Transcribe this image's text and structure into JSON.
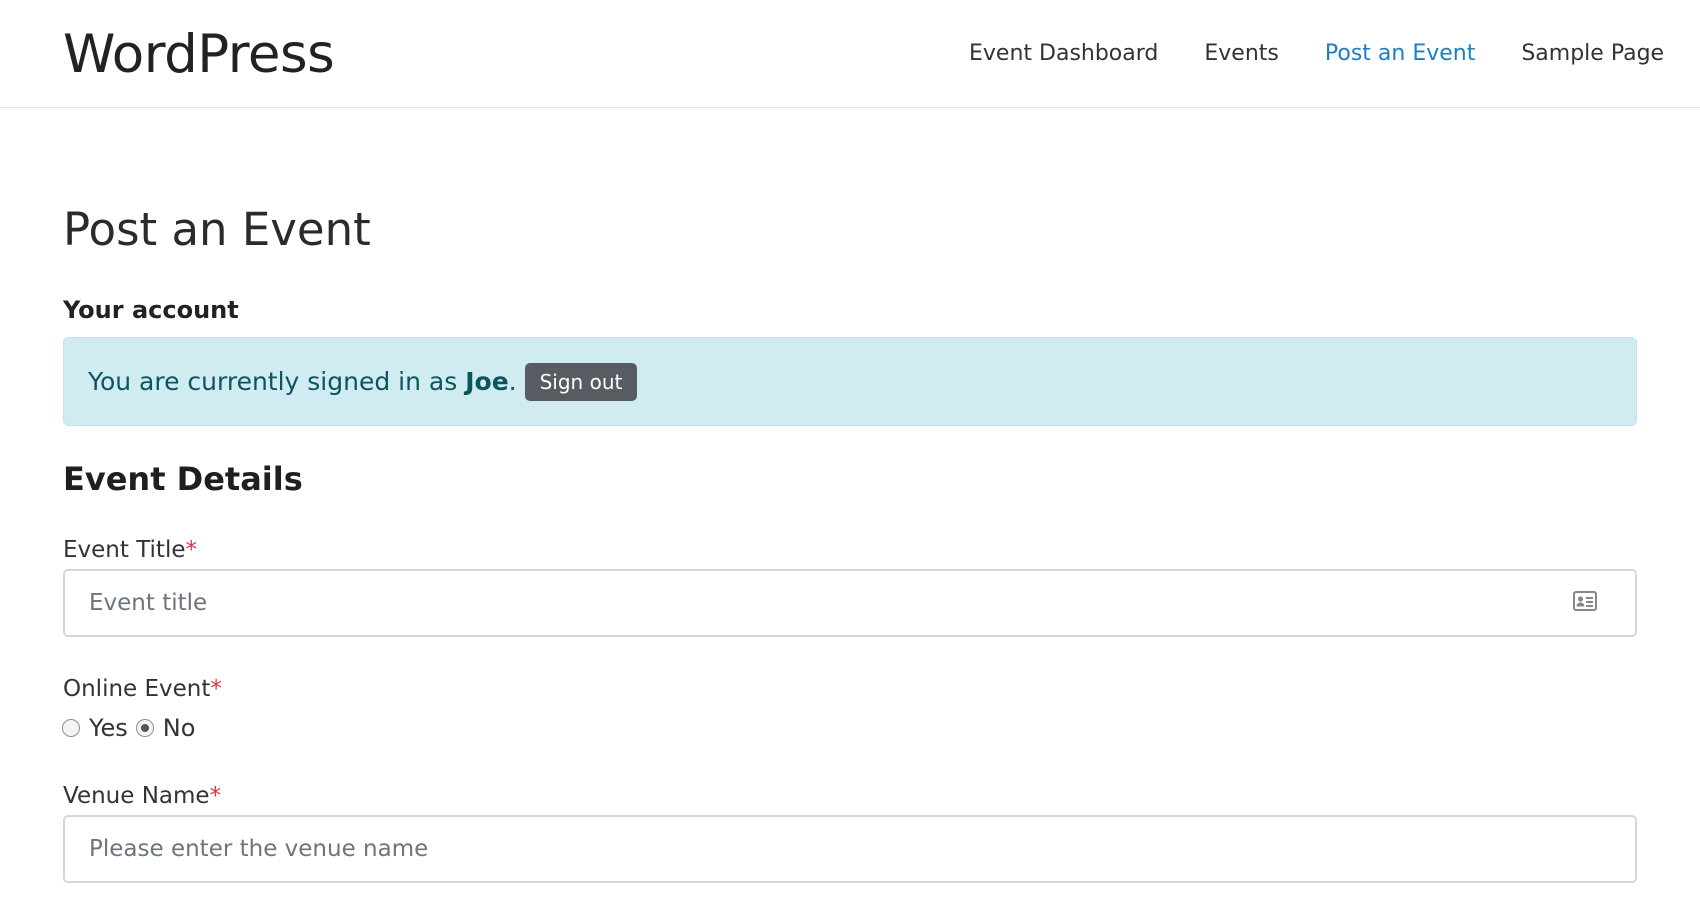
{
  "header": {
    "site_title": "WordPress",
    "nav": [
      {
        "label": "Event Dashboard",
        "active": false
      },
      {
        "label": "Events",
        "active": false
      },
      {
        "label": "Post an Event",
        "active": true
      },
      {
        "label": "Sample Page",
        "active": false
      }
    ]
  },
  "page": {
    "title": "Post an Event",
    "account_label": "Your account",
    "signed_in_prefix": "You are currently signed in as",
    "user_name": "Joe",
    "signed_in_suffix": ".",
    "sign_out_label": "Sign out"
  },
  "form": {
    "section_title": "Event Details",
    "required_mark": "*",
    "event_title": {
      "label": "Event Title",
      "placeholder": "Event title",
      "value": "",
      "icon": "address-card-icon"
    },
    "online_event": {
      "label": "Online Event",
      "options": [
        {
          "label": "Yes",
          "checked": false
        },
        {
          "label": "No",
          "checked": true
        }
      ]
    },
    "venue_name": {
      "label": "Venue Name",
      "placeholder": "Please enter the venue name",
      "value": ""
    }
  },
  "colors": {
    "nav_active": "#1d7fc1",
    "alert_bg": "#d1ecf1",
    "alert_text": "#0c5460",
    "button_bg": "#565c61",
    "required": "#dc3545"
  }
}
